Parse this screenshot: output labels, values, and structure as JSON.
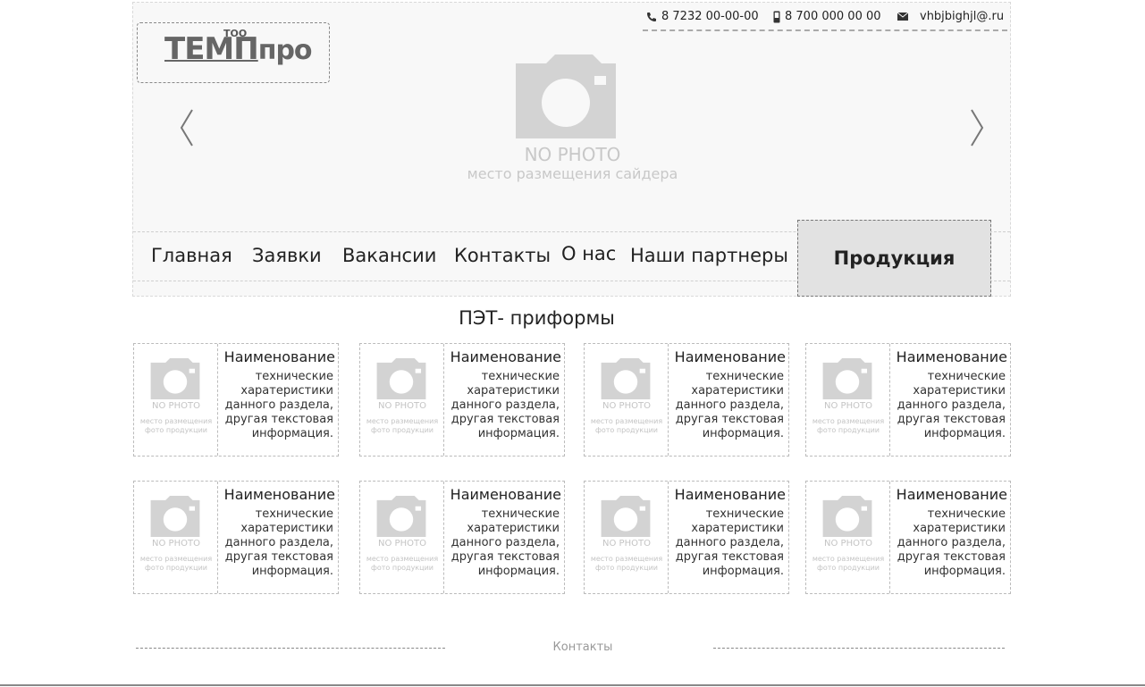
{
  "header": {
    "logo": {
      "top": "ТОО",
      "main_underlined": "ТЕМП",
      "main_rest": "про"
    },
    "contacts": [
      {
        "icon": "phone-icon",
        "text": "8 7232 00-00-00"
      },
      {
        "icon": "mobile-icon",
        "text": "8 700 000 00 00"
      },
      {
        "icon": "envelope-icon",
        "text": "vhbjbighjl@.ru"
      }
    ],
    "slider": {
      "placeholder_title": "NO PHOTO",
      "placeholder_caption": "место размещения сайдера"
    }
  },
  "menu": {
    "items": [
      "Главная",
      "Заявки",
      "Вакансии",
      "Контакты",
      "О нас",
      "Наши партнеры"
    ],
    "products_button": "Продукция"
  },
  "section": {
    "title": "ПЭТ- приформы"
  },
  "products": [
    {
      "title": "Наименование",
      "description": "технические харатеристики данного раздела, другая текстовая информация.",
      "photo_title": "NO PHOTO",
      "photo_caption": "место размещения фото продукции"
    },
    {
      "title": "Наименование",
      "description": "технические харатеристики данного раздела, другая текстовая информация.",
      "photo_title": "NO PHOTO",
      "photo_caption": "место размещения фото продукции"
    },
    {
      "title": "Наименование",
      "description": "технические харатеристики данного раздела, другая текстовая информация.",
      "photo_title": "NO PHOTO",
      "photo_caption": "место размещения фото продукции"
    },
    {
      "title": "Наименование",
      "description": "технические харатеристики данного раздела, другая текстовая информация.",
      "photo_title": "NO PHOTO",
      "photo_caption": "место размещения фото продукции"
    },
    {
      "title": "Наименование",
      "description": "технические харатеристики данного раздела, другая текстовая информация.",
      "photo_title": "NO PHOTO",
      "photo_caption": "место размещения фото продукции"
    },
    {
      "title": "Наименование",
      "description": "технические харатеристики данного раздела, другая текстовая информация.",
      "photo_title": "NO PHOTO",
      "photo_caption": "место размещения фото продукции"
    },
    {
      "title": "Наименование",
      "description": "технические харатеристики данного раздела, другая текстовая информация.",
      "photo_title": "NO PHOTO",
      "photo_caption": "место размещения фото продукции"
    },
    {
      "title": "Наименование",
      "description": "технические харатеристики данного раздела, другая текстовая информация.",
      "photo_title": "NO PHOTO",
      "photo_caption": "место размещения фото продукции"
    }
  ],
  "footer": {
    "label": "Контакты"
  },
  "colors": {
    "background": "#ffffff",
    "header_bg": "#f8f8f8",
    "placeholder": "#c8c8c8",
    "active_menu_bg": "#e2e2e2"
  }
}
